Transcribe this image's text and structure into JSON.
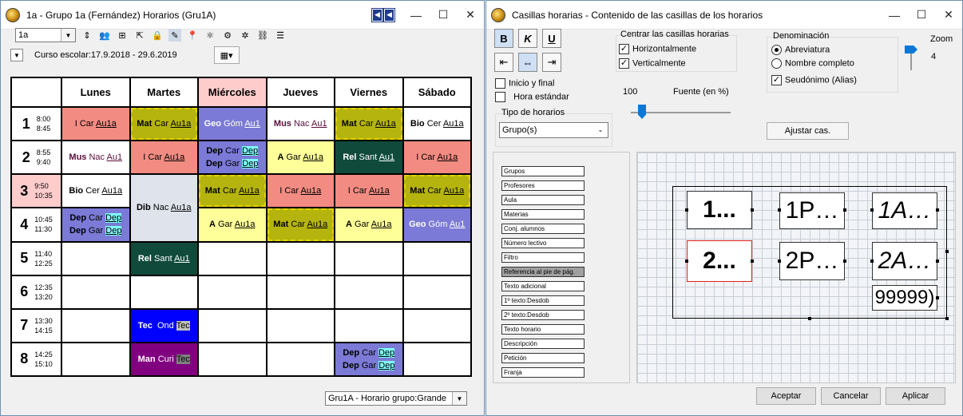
{
  "left_window": {
    "title": "1a - Grupo 1a (Fernández)  Horarios  (Gru1A)",
    "class_select": "1a",
    "school_year": "Curso escolar:17.9.2018 - 29.6.2019",
    "bottom_select": "Gru1A - Horario grupo:Grande",
    "days": [
      "Lunes",
      "Martes",
      "Miércoles",
      "Jueves",
      "Viernes",
      "Sábado"
    ],
    "periods": [
      {
        "num": "1",
        "start": "8:00",
        "end": "8:45"
      },
      {
        "num": "2",
        "start": "8:55",
        "end": "9:40"
      },
      {
        "num": "3",
        "start": "9:50",
        "end": "10:35"
      },
      {
        "num": "4",
        "start": "10:45",
        "end": "11:30"
      },
      {
        "num": "5",
        "start": "11:40",
        "end": "12:25"
      },
      {
        "num": "6",
        "start": "12:35",
        "end": "13:20"
      },
      {
        "num": "7",
        "start": "13:30",
        "end": "14:15"
      },
      {
        "num": "8",
        "start": "14:25",
        "end": "15:10"
      }
    ],
    "cells": {
      "p1_lunes": [
        "I",
        "Car",
        "Au1a"
      ],
      "p1_martes": [
        "Mat",
        "Car",
        "Au1a"
      ],
      "p1_miercoles": [
        "Geo",
        "Góm",
        "Au1"
      ],
      "p1_jueves": [
        "Mus",
        "Nac",
        "Au1"
      ],
      "p1_viernes": [
        "Mat",
        "Car",
        "Au1a"
      ],
      "p1_sabado": [
        "Bio",
        "Cer",
        "Au1a"
      ],
      "p2_lunes": [
        "Mus",
        "Nac",
        "Au1"
      ],
      "p2_martes": [
        "I",
        "Car",
        "Au1a"
      ],
      "p2_miercoles_a": [
        "Dep",
        "Car",
        "Dep"
      ],
      "p2_miercoles_b": [
        "Dep",
        "Gar",
        "Dep"
      ],
      "p2_jueves": [
        "A",
        "Gar",
        "Au1a"
      ],
      "p2_viernes": [
        "Rel",
        "Sant",
        "Au1"
      ],
      "p2_sabado": [
        "I",
        "Car",
        "Au1a"
      ],
      "p3_lunes": [
        "Bio",
        "Cer",
        "Au1a"
      ],
      "p34_martes": [
        "Dib",
        "Nac",
        "Au1a"
      ],
      "p3_miercoles": [
        "Mat",
        "Car",
        "Au1a"
      ],
      "p3_jueves": [
        "I",
        "Car",
        "Au1a"
      ],
      "p3_viernes": [
        "I",
        "Car",
        "Au1a"
      ],
      "p3_sabado": [
        "Mat",
        "Car",
        "Au1a"
      ],
      "p4_lunes_a": [
        "Dep",
        "Car",
        "Dep"
      ],
      "p4_lunes_b": [
        "Dep",
        "Gar",
        "Dep"
      ],
      "p4_miercoles": [
        "A",
        "Gar",
        "Au1a"
      ],
      "p4_jueves": [
        "Mat",
        "Car",
        "Au1a"
      ],
      "p4_viernes": [
        "A",
        "Gar",
        "Au1a"
      ],
      "p4_sabado": [
        "Geo",
        "Góm",
        "Au1"
      ],
      "p5_martes": [
        "Rel",
        "Sant",
        "Au1"
      ],
      "p7_martes": [
        "Tec",
        "Ond",
        "Tec"
      ],
      "p8_martes": [
        "Man",
        "Curi",
        "Tec"
      ],
      "p8_viernes_a": [
        "Dep",
        "Car",
        "Dep"
      ],
      "p8_viernes_b": [
        "Dep",
        "Gar",
        "Dep"
      ]
    }
  },
  "right_window": {
    "title": "Casillas horarias - Contenido de las casillas de los horarios",
    "bold_label": "B",
    "italic_label": "K",
    "underline_label": "U",
    "center_heading": "Centrar las casillas horarias",
    "horiz": "Horizontalmente",
    "vert": "Verticalmente",
    "denom_heading": "Denominación",
    "abbr": "Abreviatura",
    "fullname": "Nombre completo",
    "alias": "Seudónimo (Alias)",
    "zoom_label": "Zoom",
    "zoom_value": "4",
    "start_end": "Inicio y final",
    "std_hour": "Hora estándar",
    "font_value": "100",
    "font_label": "Fuente (en %)",
    "type_heading": "Tipo de horarios",
    "type_select": "Grupo(s)",
    "adjust_button": "Ajustar cas.",
    "fields": [
      "Grupos",
      "Profesores",
      "Aula",
      "Materias",
      "Conj. alumnos",
      "Número lectivo",
      "Filtro",
      "Referencia al pie de pág.",
      "Texto adicional",
      "1º texto:Desdob",
      "2º texto:Desdob",
      "Texto horario",
      "Descripción",
      "Petición",
      "Franja"
    ],
    "preview": {
      "b1": "1...",
      "b2": "1P…",
      "b3": "1A…",
      "b4": "2...",
      "b5": "2P…",
      "b6": "2A…",
      "b7": "99999)"
    },
    "accept": "Aceptar",
    "cancel": "Cancelar",
    "apply": "Aplicar"
  },
  "colors": {
    "red": "#f28b82",
    "yellow": "#ffff99",
    "olive": "#b5b40e",
    "purple": "#7b7ad6",
    "darkgreen": "#0f4a3a",
    "blue": "#0000ff",
    "violet": "#800080",
    "pink": "#ffcccc",
    "grey": "#dfe3ec"
  }
}
